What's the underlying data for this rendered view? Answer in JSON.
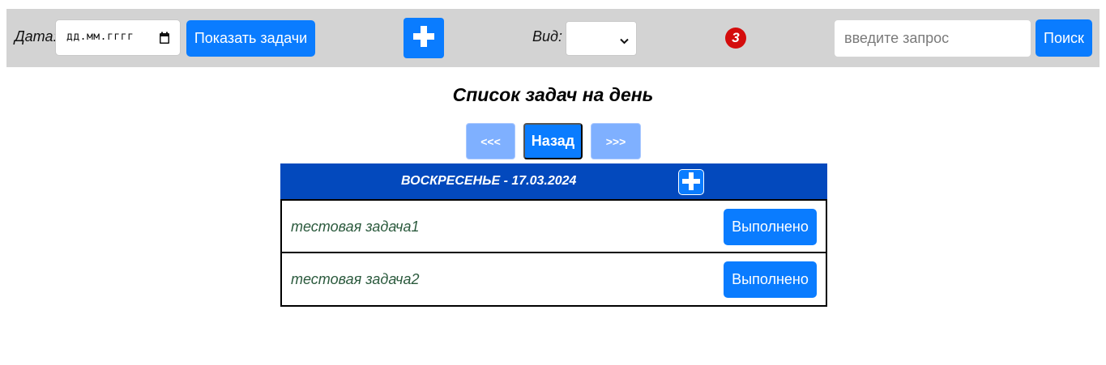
{
  "toolbar": {
    "date_label": "Дата:",
    "date_value": "дд.мм.гггг",
    "show_button": "Показать задачи",
    "add_button_icon": "plus-icon",
    "view_label": "Вид:",
    "view_selected": "",
    "notification_count": "3",
    "search_placeholder": "введите запрос",
    "search_button": "Поиск",
    "colors": {
      "toolbar_bg": "#d3d3d3",
      "accent": "#0a7cff",
      "badge": "#d40c0c"
    }
  },
  "main": {
    "title": "Список задач на день",
    "nav": {
      "prev": "<<<",
      "back": "Назад",
      "next": ">>>"
    },
    "day": {
      "title": "ВОСКРЕСЕНЬЕ - 17.03.2024",
      "add_icon": "plus-icon",
      "header_color": "#0349bd",
      "tasks": [
        {
          "text": "тестовая задача1",
          "action": "Выполнено"
        },
        {
          "text": "тестовая задача2",
          "action": "Выполнено"
        }
      ]
    }
  }
}
